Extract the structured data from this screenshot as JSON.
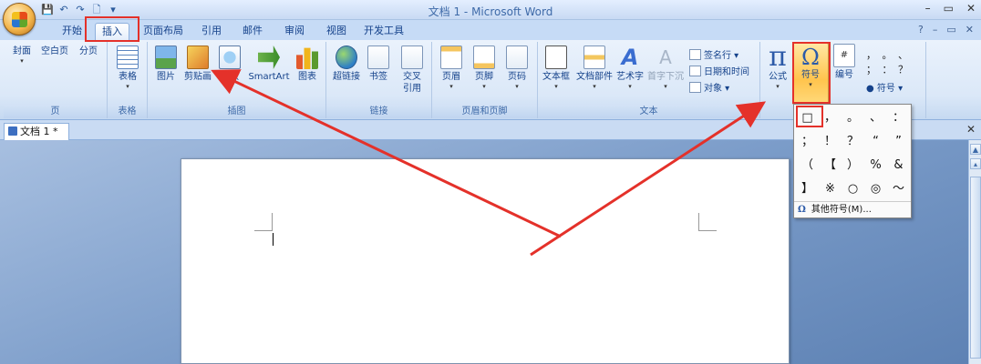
{
  "window": {
    "title": "文档 1 - Microsoft Word",
    "controls": [
      "–",
      "▭",
      "✕"
    ]
  },
  "qat": [
    "💾",
    "↶",
    "↷",
    "🗋",
    "▾"
  ],
  "tabs": [
    {
      "label": "开始"
    },
    {
      "label": "插入"
    },
    {
      "label": "页面布局"
    },
    {
      "label": "引用"
    },
    {
      "label": "邮件"
    },
    {
      "label": "审阅"
    },
    {
      "label": "视图"
    },
    {
      "label": "开发工具"
    }
  ],
  "tabs_right": [
    "?",
    "–",
    "▭",
    "✕"
  ],
  "ribbon": {
    "groups": {
      "pages": "页",
      "tables": "表格",
      "illustrations": "插图",
      "links": "链接",
      "header_footer": "页眉和页脚",
      "text": "文本"
    },
    "buttons": {
      "cover": "封面",
      "blank_page": "空白页",
      "page_break": "分页",
      "table": "表格",
      "picture": "图片",
      "clipart": "剪贴画",
      "shapes": "形状",
      "smartart": "SmartArt",
      "chart": "图表",
      "hyperlink": "超链接",
      "bookmark": "书签",
      "xref_1": "交叉",
      "xref_2": "引用",
      "header": "页眉",
      "footer": "页脚",
      "page_number": "页码",
      "textbox": "文本框",
      "quick_parts": "文档部件",
      "wordart": "艺术字",
      "dropcap": "首字下沉",
      "equation": "公式",
      "symbol": "符号",
      "numbering": "编号"
    },
    "small_commands": {
      "signature_line": "签名行 ▾",
      "date_time": "日期和时间",
      "object": "对象 ▾"
    },
    "special_symbols": {
      "rows": [
        [
          "，",
          "。",
          "、"
        ],
        [
          "；",
          "：",
          "？"
        ]
      ],
      "label": "符号 ▾"
    },
    "icons": {
      "wordart_glyph": "A",
      "dropcap_glyph": "A",
      "equation_glyph": "π",
      "symbol_glyph": "Ω",
      "numbering_glyph": "#"
    }
  },
  "doc_tab": {
    "label": "文档 1 *",
    "close": "✕"
  },
  "symbol_menu": {
    "symbols": [
      "□",
      "，",
      "。",
      "、",
      "：",
      "；",
      "！",
      "？",
      "“",
      "”",
      "（",
      "【",
      "）",
      "%",
      "&",
      "】",
      "※",
      "○",
      "◎",
      "～"
    ],
    "more_label": "其他符号(M)...",
    "more_glyph": "Ω"
  },
  "colors": {
    "annotation": "#e4312a",
    "highlight": "#ffc44d"
  }
}
